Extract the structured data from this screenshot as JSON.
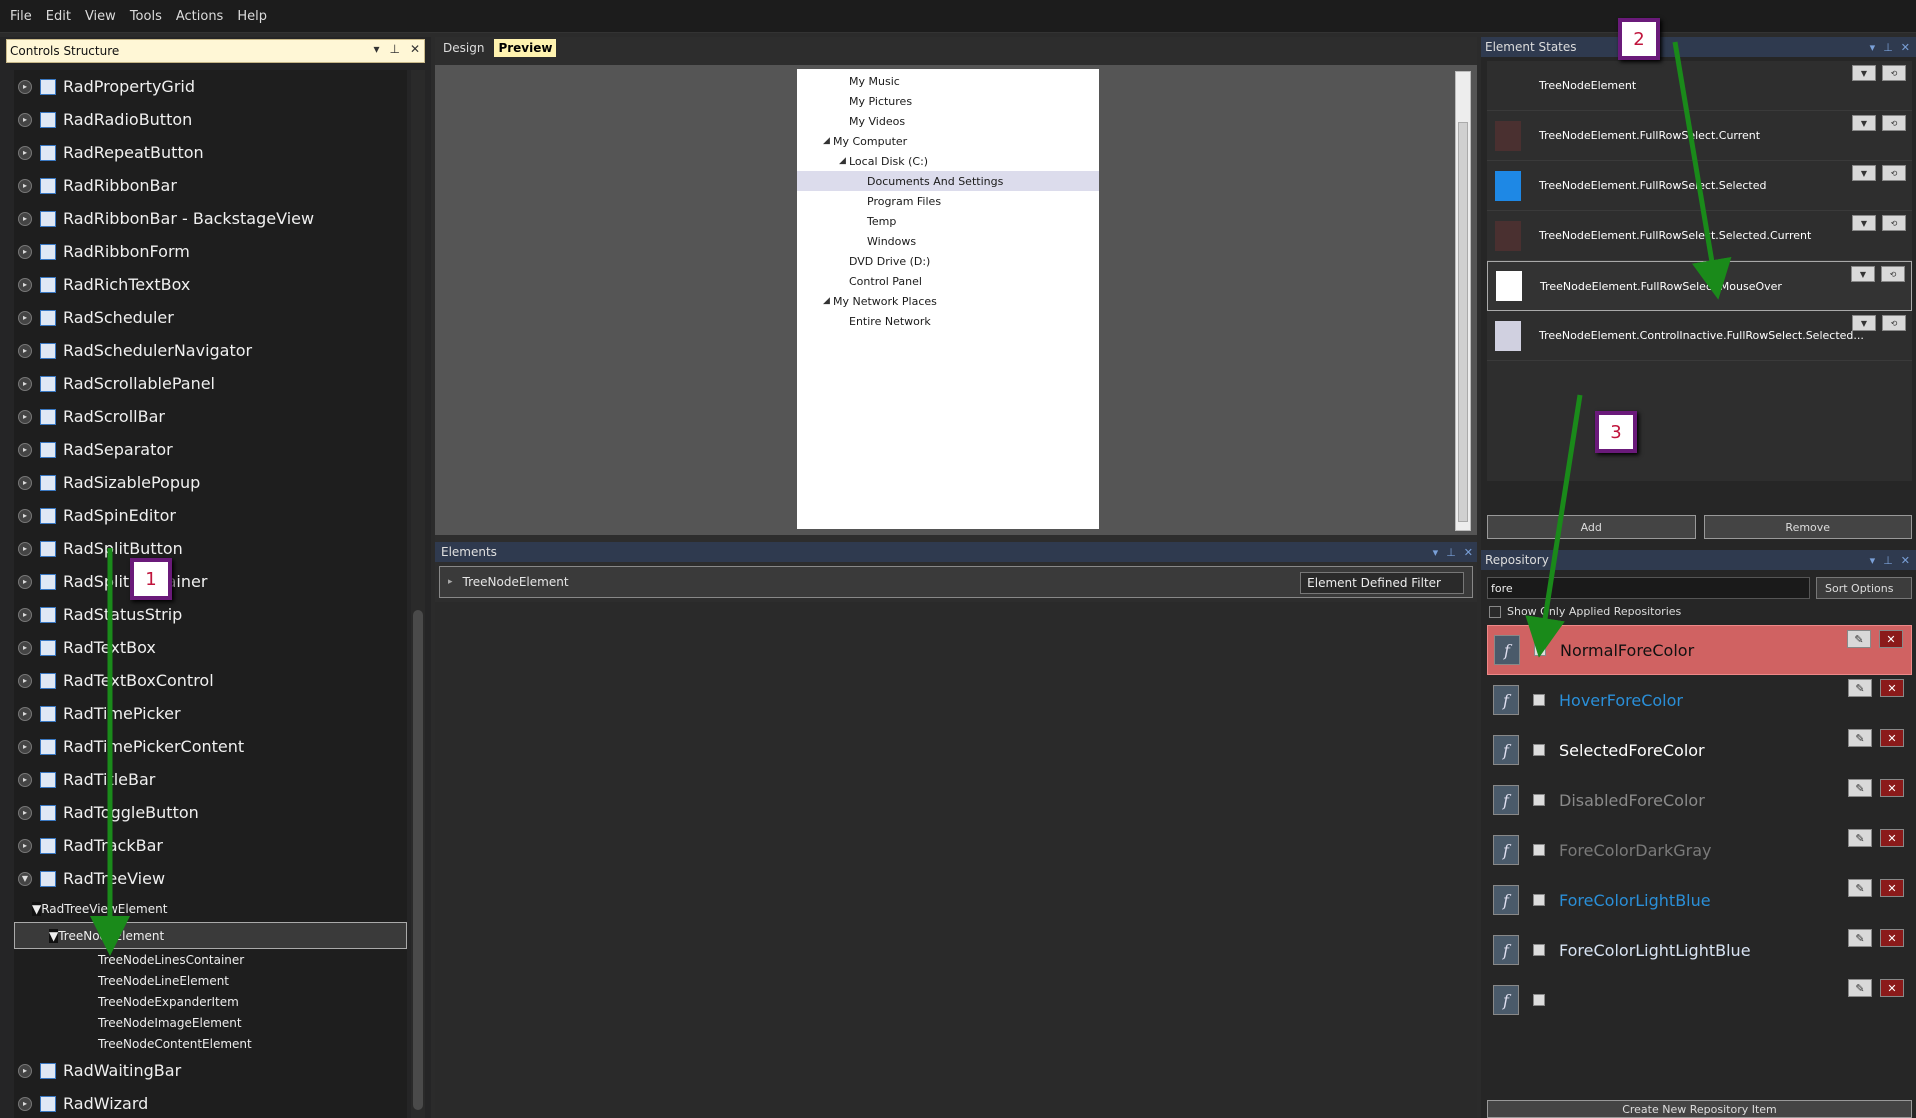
{
  "menu": [
    "File",
    "Edit",
    "View",
    "Tools",
    "Actions",
    "Help"
  ],
  "left_panel": {
    "title": "Controls Structure",
    "controls": [
      "RadPropertyGrid",
      "RadRadioButton",
      "RadRepeatButton",
      "RadRibbonBar",
      "RadRibbonBar - BackstageView",
      "RadRibbonForm",
      "RadRichTextBox",
      "RadScheduler",
      "RadSchedulerNavigator",
      "RadScrollablePanel",
      "RadScrollBar",
      "RadSeparator",
      "RadSizablePopup",
      "RadSpinEditor",
      "RadSplitButton",
      "RadSplitContainer",
      "RadStatusStrip",
      "RadTextBox",
      "RadTextBoxControl",
      "RadTimePicker",
      "RadTimePickerContent",
      "RadTitleBar",
      "RadToggleButton",
      "RadTrackBar",
      "RadTreeView"
    ],
    "sub_element": "RadTreeViewElement",
    "selected_element": "TreeNodeElement",
    "children": [
      "TreeNodeLinesContainer",
      "TreeNodeLineElement",
      "TreeNodeExpanderItem",
      "TreeNodeImageElement",
      "TreeNodeContentElement"
    ],
    "after": [
      "RadWaitingBar",
      "RadWizard"
    ]
  },
  "center": {
    "tab_design": "Design",
    "tab_preview": "Preview",
    "preview_nodes": [
      "My Music",
      "My Pictures",
      "My Videos",
      "My Computer",
      "Local Disk (C:)",
      "Documents And Settings",
      "Program Files",
      "Temp",
      "Windows",
      "DVD Drive (D:)",
      "Control Panel",
      "My Network Places",
      "Entire Network"
    ],
    "elements_title": "Elements",
    "elements_row": "TreeNodeElement",
    "filter_label": "Element Defined Filter"
  },
  "right": {
    "states_title": "Element States",
    "states": [
      "TreeNodeElement",
      "TreeNodeElement.FullRowSelect.Current",
      "TreeNodeElement.FullRowSelect.Selected",
      "TreeNodeElement.FullRowSelect.Selected.Current",
      "TreeNodeElement.FullRowSelect.MouseOver",
      "TreeNodeElement.ControlInactive.FullRowSelect.Selected..."
    ],
    "add_label": "Add",
    "remove_label": "Remove",
    "repo_title": "Repository",
    "search_value": "fore",
    "sort_label": "Sort Options",
    "show_only_label": "Show Only Applied Repositories",
    "repo_items": [
      {
        "name": "NormalForeColor",
        "color": "#111111"
      },
      {
        "name": "HoverForeColor",
        "color": "#2a8fd8"
      },
      {
        "name": "SelectedForeColor",
        "color": "#ffffff"
      },
      {
        "name": "DisabledForeColor",
        "color": "#8a8a8a"
      },
      {
        "name": "ForeColorDarkGray",
        "color": "#7a7a7a"
      },
      {
        "name": "ForeColorLightBlue",
        "color": "#2a8fd8"
      },
      {
        "name": "ForeColorLightLightBlue",
        "color": "#d8e4f4"
      },
      {
        "name": "",
        "color": "#111111"
      }
    ],
    "create_label": "Create New Repository Item"
  },
  "badges": [
    "1",
    "2",
    "3"
  ]
}
